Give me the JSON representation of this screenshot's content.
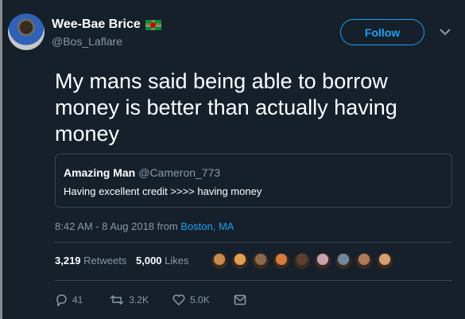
{
  "author": {
    "display_name": "Wee-Bae Brice",
    "handle": "@Bos_Laflare"
  },
  "follow_label": "Follow",
  "tweet_text": "My mans said being able to borrow money is better than actually having money",
  "quoted_tweet": {
    "display_name": "Amazing Man",
    "handle": "@Cameron_773",
    "text": "Having excellent credit >>>> having money"
  },
  "timestamp": "8:42 AM - 8 Aug 2018 from",
  "location": "Boston, MA",
  "stats": {
    "retweets_count": "3,219",
    "retweets_label": "Retweets",
    "likes_count": "5,000",
    "likes_label": "Likes"
  },
  "likers": [
    {
      "color": "#c98a4a"
    },
    {
      "color": "#e0a050"
    },
    {
      "color": "#8a6a4a"
    },
    {
      "color": "#d87a3a"
    },
    {
      "color": "#5a4030"
    },
    {
      "color": "#c8a0b0"
    },
    {
      "color": "#6a8aa0"
    },
    {
      "color": "#b07a5a"
    },
    {
      "color": "#d8a070"
    }
  ],
  "actions": {
    "replies": "41",
    "retweets": "3.2K",
    "likes": "5.0K"
  },
  "icons": {
    "reply": "reply-icon",
    "retweet": "retweet-icon",
    "like": "heart-icon",
    "message": "message-icon",
    "caret": "chevron-down-icon"
  },
  "colors": {
    "background": "#15202b",
    "accent": "#1da1f2",
    "secondary_text": "#8899a6",
    "border": "#38444d"
  }
}
